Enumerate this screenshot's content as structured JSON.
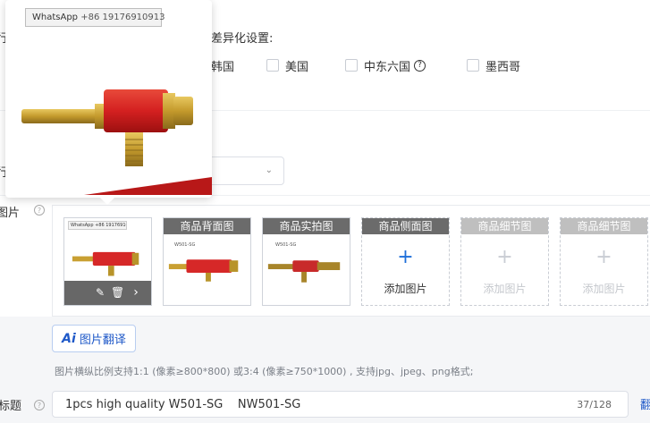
{
  "top": {
    "cut_label_1": "行",
    "diff_settings_label": "差异化设置:",
    "countries": [
      {
        "label": "韩国",
        "checked": false
      },
      {
        "label": "美国",
        "checked": false
      },
      {
        "label": "中东六国",
        "checked": false,
        "help": "?"
      },
      {
        "label": "墨西哥",
        "checked": false
      }
    ]
  },
  "middle": {
    "cut_label_2": "行",
    "select_caret": "⌄"
  },
  "images": {
    "label": "图片",
    "help_icon": "?",
    "main_watermark": "WhatsApp +86 19176910913",
    "slots": [
      {
        "header": "",
        "type": "main",
        "label": "",
        "caption": ""
      },
      {
        "header": "商品背面图",
        "type": "image",
        "caption": "W501-SG"
      },
      {
        "header": "商品实拍图",
        "type": "image",
        "caption": "W501-SG"
      },
      {
        "header": "商品侧面图",
        "type": "add",
        "label": "添加图片",
        "enabled": true
      },
      {
        "header": "商品细节图",
        "type": "add",
        "label": "添加图片",
        "enabled": false
      },
      {
        "header": "商品细节图",
        "type": "add",
        "label": "添加图片",
        "enabled": false
      }
    ],
    "plus_symbol": "+",
    "edit_icon": "✎",
    "delete_icon": "🗑",
    "next_icon": "›"
  },
  "ai_translate": {
    "mark": "Ai",
    "label": "图片翻译"
  },
  "format_note": "图片横纵比例支持1:1 (像素≥800*800) 或3:4 (像素≥750*1000) , 支持jpg、jpeg、png格式;",
  "title_field": {
    "label": "标题",
    "help_icon": "?",
    "value": "1pcs high quality W501-SG    NW501-SG",
    "count": "37/128",
    "translate_link": "翻"
  },
  "popover": {
    "watermark_app": "WhatsApp",
    "watermark_number": "+86 19176910913"
  },
  "colors": {
    "accent": "#1e58c8",
    "header_dark": "#6b6b6b",
    "header_light": "#bfbfbf",
    "product_red": "#d62828",
    "brass": "#b8942a"
  }
}
